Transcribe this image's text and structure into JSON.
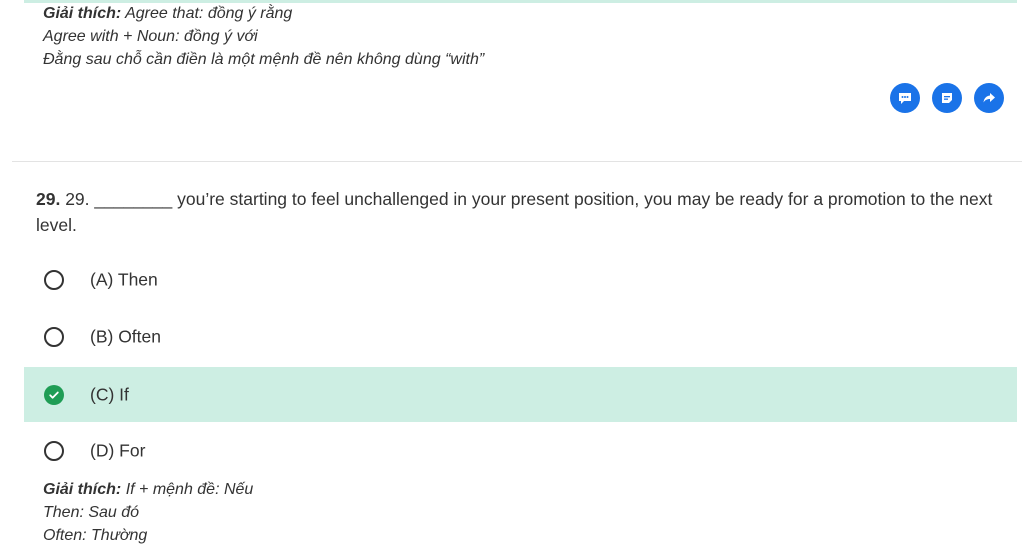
{
  "prev_explanation": {
    "label": "Giải thích:",
    "line1": "Agree that: đồng ý rằng",
    "line2": "Agree with + Noun: đồng ý với",
    "line3": "Đằng sau chỗ cần điền là một mệnh đề nên không dùng “with”"
  },
  "actions": {
    "icons": [
      "comment-icon",
      "note-icon",
      "share-icon"
    ],
    "color": "#1a73e8"
  },
  "question": {
    "number": "29.",
    "text": "29. ________ you’re starting to feel unchallenged in your present position, you may be ready for a promotion to the next level."
  },
  "options": [
    {
      "label": "(A) Then",
      "selected": false
    },
    {
      "label": "(B) Often",
      "selected": false
    },
    {
      "label": "(C) If",
      "selected": true
    },
    {
      "label": "(D) For",
      "selected": false
    }
  ],
  "explanation": {
    "label": "Giải thích:",
    "line1": "If + mệnh đề: Nếu",
    "line2": "Then: Sau đó",
    "line3": "Often: Thường"
  },
  "colors": {
    "selected_bg": "#cdeee3",
    "check_green": "#1f9d55"
  }
}
